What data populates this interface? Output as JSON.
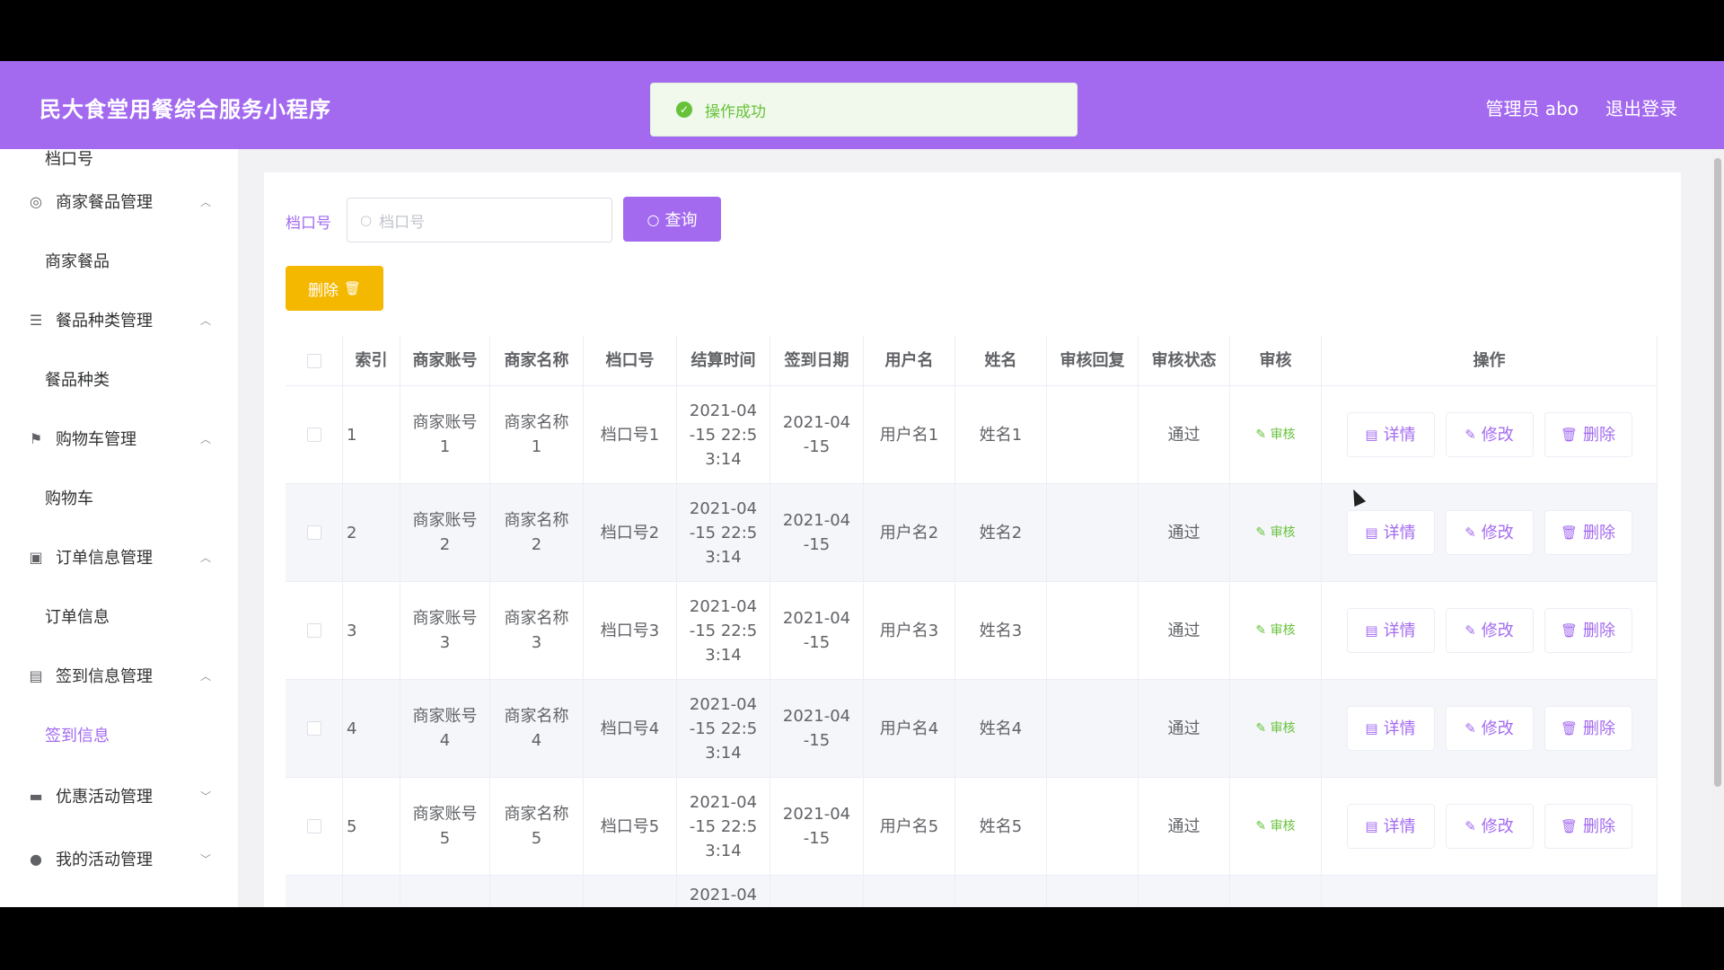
{
  "header": {
    "app_title": "民大食堂用餐综合服务小程序",
    "admin_label": "管理员 abo",
    "logout_label": "退出登录"
  },
  "toast": {
    "message": "操作成功",
    "icon": "check-circle-icon",
    "color": "#67c23a"
  },
  "sidebar": {
    "top_partial": "档口号",
    "groups": [
      {
        "label": "商家餐品管理",
        "icon": "compass-icon",
        "child": "商家餐品",
        "expanded": true
      },
      {
        "label": "餐品种类管理",
        "icon": "list-icon",
        "child": "餐品种类",
        "expanded": true
      },
      {
        "label": "购物车管理",
        "icon": "flag-icon",
        "child": "购物车",
        "expanded": true
      },
      {
        "label": "订单信息管理",
        "icon": "order-icon",
        "child": "订单信息",
        "expanded": true
      },
      {
        "label": "签到信息管理",
        "icon": "clipboard-icon",
        "child": "签到信息",
        "expanded": true,
        "active_child": true
      },
      {
        "label": "优惠活动管理",
        "icon": "ticket-icon",
        "expanded": false
      },
      {
        "label": "我的活动管理",
        "icon": "location-icon",
        "expanded": false
      }
    ]
  },
  "search": {
    "label": "档口号",
    "placeholder": "档口号",
    "query_button": "查询",
    "delete_button": "删除"
  },
  "table": {
    "columns": [
      "",
      "索引",
      "商家账号",
      "商家名称",
      "档口号",
      "结算时间",
      "签到日期",
      "用户名",
      "姓名",
      "审核回复",
      "审核状态",
      "审核",
      "操作"
    ],
    "rows": [
      {
        "index": "1",
        "account": "商家账号\n1",
        "name": "商家名称\n1",
        "stall": "档口号1",
        "settle_time": "2021-04\n-15 22:5\n3:14",
        "sign_date": "2021-04\n-15",
        "username": "用户名1",
        "realname": "姓名1",
        "reply": "",
        "status": "通过",
        "audit": "审核"
      },
      {
        "index": "2",
        "account": "商家账号\n2",
        "name": "商家名称\n2",
        "stall": "档口号2",
        "settle_time": "2021-04\n-15 22:5\n3:14",
        "sign_date": "2021-04\n-15",
        "username": "用户名2",
        "realname": "姓名2",
        "reply": "",
        "status": "通过",
        "audit": "审核"
      },
      {
        "index": "3",
        "account": "商家账号\n3",
        "name": "商家名称\n3",
        "stall": "档口号3",
        "settle_time": "2021-04\n-15 22:5\n3:14",
        "sign_date": "2021-04\n-15",
        "username": "用户名3",
        "realname": "姓名3",
        "reply": "",
        "status": "通过",
        "audit": "审核"
      },
      {
        "index": "4",
        "account": "商家账号\n4",
        "name": "商家名称\n4",
        "stall": "档口号4",
        "settle_time": "2021-04\n-15 22:5\n3:14",
        "sign_date": "2021-04\n-15",
        "username": "用户名4",
        "realname": "姓名4",
        "reply": "",
        "status": "通过",
        "audit": "审核"
      },
      {
        "index": "5",
        "account": "商家账号\n5",
        "name": "商家名称\n5",
        "stall": "档口号5",
        "settle_time": "2021-04\n-15 22:5\n3:14",
        "sign_date": "2021-04\n-15",
        "username": "用户名5",
        "realname": "姓名5",
        "reply": "",
        "status": "通过",
        "audit": "审核"
      }
    ],
    "partial_row_text": "2021-04",
    "actions": {
      "detail": "详情",
      "edit": "修改",
      "delete": "删除"
    }
  },
  "colors": {
    "accent": "#a36af0",
    "warning": "#f5b800",
    "success": "#67c23a"
  }
}
